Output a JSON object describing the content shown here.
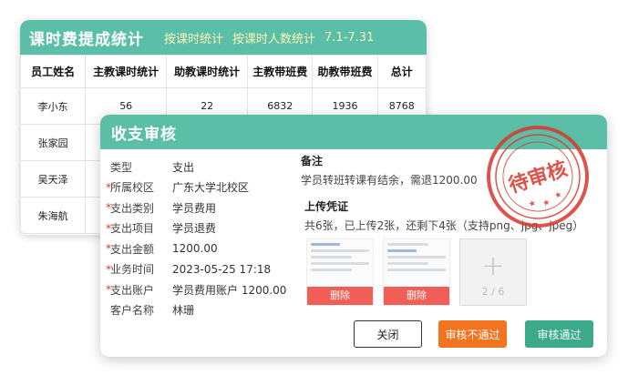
{
  "commission": {
    "title": "课时费提成统计",
    "link_by_lesson": "按课时统计",
    "link_by_students": "按课时人数统计",
    "date_range": "7.1-7.31",
    "columns": [
      "员工姓名",
      "主教课时统计",
      "助教课时统计",
      "主教带班费",
      "助教带班费",
      "总计"
    ],
    "rows": [
      [
        "李小东",
        "56",
        "22",
        "6832",
        "1936",
        "8768"
      ],
      [
        "张家园",
        "",
        "",
        "",
        "",
        ""
      ],
      [
        "吴天泽",
        "",
        "",
        "",
        "",
        ""
      ],
      [
        "朱海航",
        "",
        "",
        "",
        "",
        ""
      ]
    ]
  },
  "audit": {
    "title": "收支审核",
    "fields": [
      {
        "required": false,
        "label": "类型",
        "value": "支出"
      },
      {
        "required": true,
        "label": "所属校区",
        "value": "广东大学北校区"
      },
      {
        "required": true,
        "label": "支出类别",
        "value": "学员费用"
      },
      {
        "required": true,
        "label": "支出项目",
        "value": "学员退费"
      },
      {
        "required": true,
        "label": "支出金额",
        "value": "1200.00"
      },
      {
        "required": true,
        "label": "业务时间",
        "value": "2023-05-25 17:18"
      },
      {
        "required": true,
        "label": "支出账户",
        "value": "学员费用账户 1200.00"
      },
      {
        "required": false,
        "label": "客户名称",
        "value": "林珊"
      }
    ],
    "remark_title": "备注",
    "remark_text": "学员转班转课有结余，需退1200.00",
    "upload_title": "上传凭证",
    "upload_text": "共6张，已上传2张，还剩下4张（支持png、jpg、jpeg）",
    "delete_label": "删除",
    "add_icon": "+",
    "upload_count": "2 / 6",
    "stamp_text": "待审核",
    "buttons": {
      "close": "关闭",
      "reject": "审核不通过",
      "approve": "审核通过"
    },
    "colors": {
      "header": "#5bbfa8",
      "reject": "#f4731f",
      "approve": "#3aaa8a",
      "delete": "#f05e57",
      "stamp": "#d9362b"
    }
  }
}
